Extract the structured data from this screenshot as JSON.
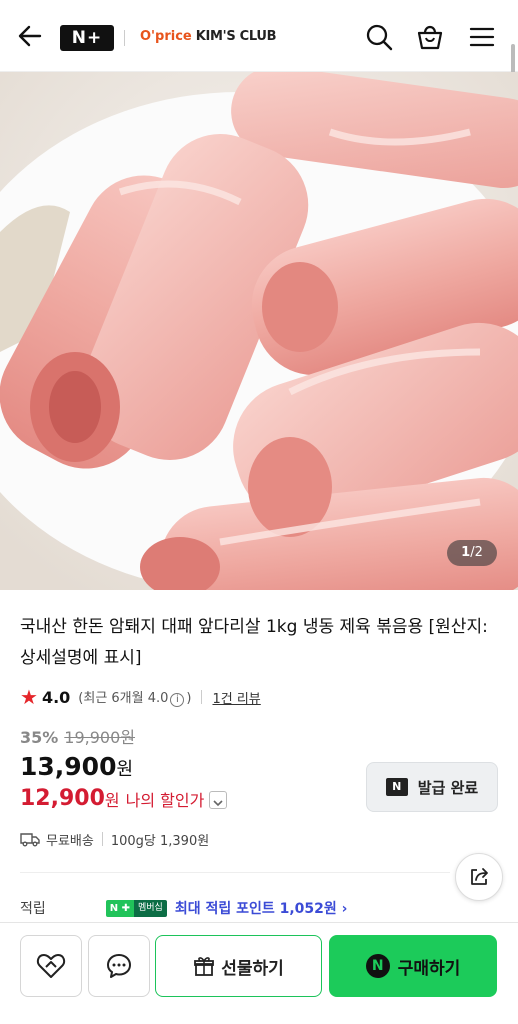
{
  "header": {
    "logo_text": "N+",
    "brand_op": "O'price",
    "brand_name": "KIM'S CLUB"
  },
  "gallery": {
    "current": "1",
    "total": "2",
    "separator": "/"
  },
  "product": {
    "title": "국내산 한돈 암퇘지 대패 앞다리살 1kg 냉동 제육 볶음용 [원산지:상세설명에 표시]"
  },
  "rating": {
    "score": "4.0",
    "recent_prefix": "(최근 6개월 4.0",
    "info_icon_glyph": "i",
    "recent_suffix": ")",
    "review_link": "1건 리뷰"
  },
  "price": {
    "discount_rate": "35%",
    "original": "19,900원",
    "sale": "13,900",
    "won": "원",
    "my_price": "12,900",
    "my_price_label": "나의 할인가"
  },
  "coupon": {
    "badge": "N",
    "label": "발급 완료"
  },
  "shipping": {
    "free": "무료배송",
    "unit_price": "100g당 1,390원"
  },
  "points": {
    "label": "적립",
    "badge_n": "N ✚",
    "badge_text": "멤버십",
    "text": "최대 적립 포인트 1,052원 ›"
  },
  "bottom": {
    "gift_label": "선물하기",
    "buy_badge": "N",
    "buy_label": "구매하기"
  },
  "colors": {
    "accent_red": "#d41c32",
    "naver_green": "#1ccb5a",
    "point_blue": "#3b4bd6"
  }
}
